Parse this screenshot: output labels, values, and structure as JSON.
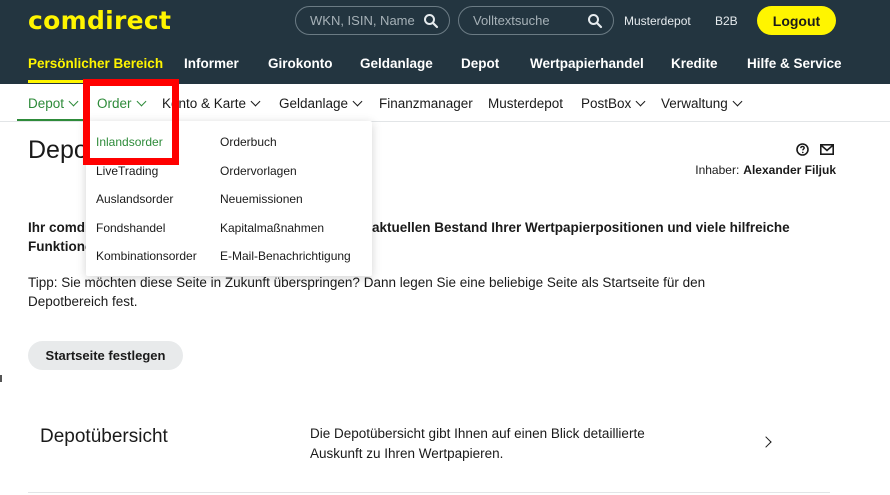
{
  "header": {
    "logo": "comdirect",
    "search_wkn_placeholder": "WKN, ISIN, Name",
    "search_fulltext_placeholder": "Volltextsuche",
    "links": [
      "Musterdepot",
      "B2B"
    ],
    "logout_label": "Logout",
    "brand_yellow": "#fff500",
    "header_bg": "#233540"
  },
  "main_nav": {
    "items": [
      "Persönlicher Bereich",
      "Informer",
      "Girokonto",
      "Geldanlage",
      "Depot",
      "Wertpapierhandel",
      "Kredite",
      "Hilfe & Service"
    ],
    "active": "Persönlicher Bereich"
  },
  "sub_nav": {
    "items": [
      "Depot",
      "Order",
      "Konto & Karte",
      "Geldanlage",
      "Finanzmanager",
      "Musterdepot",
      "PostBox",
      "Verwaltung"
    ],
    "accent": "#2e8b3a"
  },
  "dropdown": {
    "col1": [
      "Inlandsorder",
      "LiveTrading",
      "Auslandsorder",
      "Fondshandel",
      "Kombinationsorder"
    ],
    "col2": [
      "Orderbuch",
      "Ordervorlagen",
      "Neuemissionen",
      "Kapitalmaßnahmen",
      "E-Mail-Benachrichtigung"
    ]
  },
  "page": {
    "title": "Depot",
    "owner_label": "Inhaber:",
    "owner_name": "Alexander Filjuk",
    "intro_line1": "Ihr comdi",
    "intro_line1_right": "aktuellen Bestand Ihrer Wertpapierpositionen und viele hilfreiche",
    "intro_line2": "Funktione",
    "tip_line1": "Tipp: Sie möchten diese Seite in Zukunft überspringen? Dann legen Sie eine beliebige Seite als Startseite für den",
    "tip_line2": "Depotbereich fest.",
    "start_button": "Startseite festlegen"
  },
  "card": {
    "title": "Depotübersicht",
    "desc_line1": "Die Depotübersicht gibt Ihnen auf einen Blick detaillierte",
    "desc_line2": "Auskunft zu Ihren Wertpapieren."
  },
  "icons": {
    "search": "magnifier-icon",
    "help": "question-circle-icon",
    "mail": "envelope-icon",
    "chevron": "chevron-down-icon"
  }
}
